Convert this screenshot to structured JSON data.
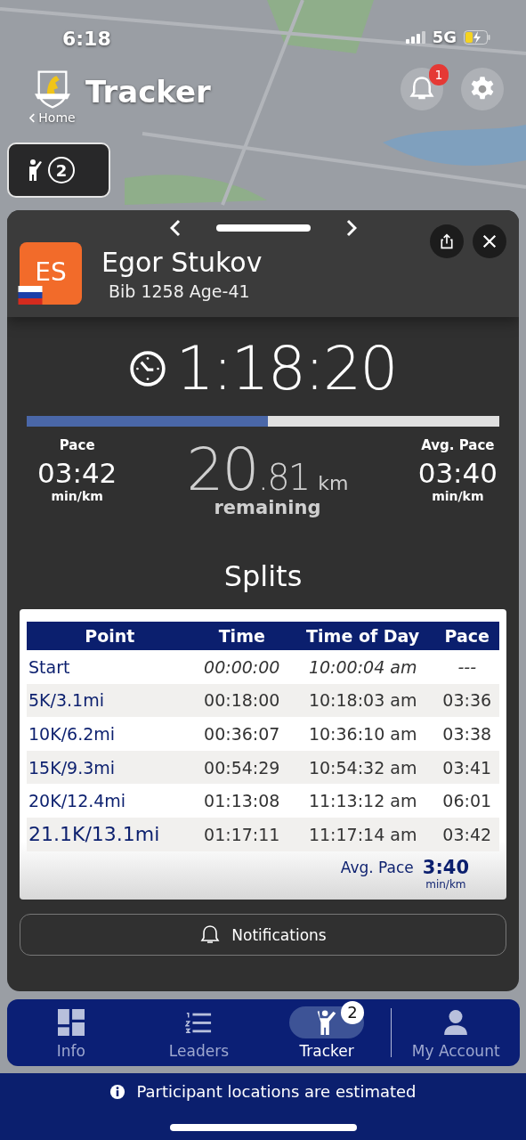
{
  "status_bar": {
    "time": "6:18",
    "network": "5G"
  },
  "header": {
    "title": "Tracker",
    "back_link": "Home",
    "notification_count": "1"
  },
  "tracked_chip": {
    "count": "2"
  },
  "runner": {
    "initials": "ES",
    "name": "Egor Stukov",
    "details": "Bib 1258 Age-41",
    "elapsed": "1:18:20",
    "progress": {
      "level": 0.51
    },
    "pace": {
      "label": "Pace",
      "value": "03:42",
      "unit": "min/km"
    },
    "remaining": {
      "whole": "20",
      "fraction": ".81",
      "unit": "km",
      "label": "remaining"
    },
    "avg_pace": {
      "label": "Avg. Pace",
      "value": "03:40",
      "unit": "min/km"
    }
  },
  "splits": {
    "title": "Splits",
    "columns": [
      "Point",
      "Time",
      "Time of Day",
      "Pace"
    ],
    "rows": [
      {
        "kind": "start",
        "cells": [
          "Start",
          "00:00:00",
          "10:00:04 am",
          "---"
        ]
      },
      {
        "kind": "split",
        "cells": [
          "5K/3.1mi",
          "00:18:00",
          "10:18:03 am",
          "03:36"
        ]
      },
      {
        "kind": "split",
        "cells": [
          "10K/6.2mi",
          "00:36:07",
          "10:36:10 am",
          "03:38"
        ]
      },
      {
        "kind": "split",
        "cells": [
          "15K/9.3mi",
          "00:54:29",
          "10:54:32 am",
          "03:41"
        ]
      },
      {
        "kind": "split",
        "cells": [
          "20K/12.4mi",
          "01:13:08",
          "11:13:12 am",
          "06:01"
        ]
      },
      {
        "kind": "split",
        "cells": [
          "21.1K/13.1mi",
          "01:17:11",
          "11:17:14 am",
          "03:42"
        ]
      }
    ],
    "summary": {
      "label": "Avg. Pace",
      "value": "3:40",
      "unit": "min/km"
    }
  },
  "notifications_button": "Notifications",
  "tabs": [
    {
      "label": "Info",
      "selected": false
    },
    {
      "label": "Leaders",
      "selected": false
    },
    {
      "label": "Tracker",
      "selected": true,
      "badge": "2"
    },
    {
      "label": "My Account",
      "selected": false
    }
  ],
  "footer_notice": "Participant locations are estimated"
}
